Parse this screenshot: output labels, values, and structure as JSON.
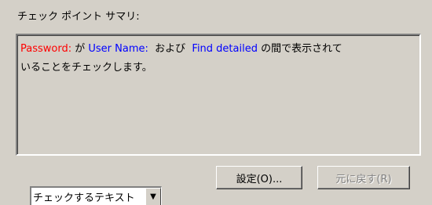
{
  "group": {
    "label": "チェック ポイント サマリ:"
  },
  "summary": {
    "password_label": "Password:",
    "particle_ga": " が ",
    "user_name_label": "User Name:",
    "and_text": "  および  ",
    "find_detailed_label": "Find detailed",
    "line1_rest": " の間で表示されて",
    "line2": "いることをチェックします。"
  },
  "buttons": {
    "settings_label": "設定(O)...",
    "revert_label": "元に戻す(R)"
  },
  "dropdown": {
    "selected": "チェックするテキスト"
  },
  "colors": {
    "password": "#ff0000",
    "field_names": "#0000ff",
    "disabled": "#808080"
  }
}
